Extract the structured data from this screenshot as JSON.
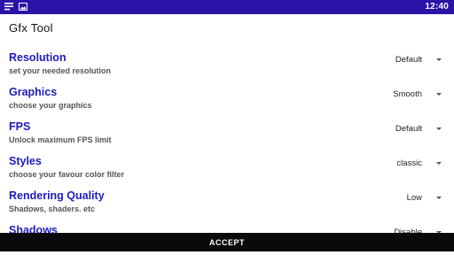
{
  "status_bar": {
    "time": "12:40",
    "background": "#2a13a7",
    "icons": [
      "notes-icon",
      "image-icon"
    ]
  },
  "app": {
    "title": "Gfx Tool"
  },
  "settings": [
    {
      "title": "Resolution",
      "subtitle": "set your needed resolution",
      "value": "Default"
    },
    {
      "title": "Graphics",
      "subtitle": "choose your graphics",
      "value": "Smooth"
    },
    {
      "title": "FPS",
      "subtitle": "Unlock maximum FPS limit",
      "value": "Default"
    },
    {
      "title": "Styles",
      "subtitle": "choose your favour color filter",
      "value": "classic"
    },
    {
      "title": "Rendering Quality",
      "subtitle": "Shadows, shaders. etc",
      "value": "Low"
    },
    {
      "title": "Shadows",
      "subtitle": "",
      "value": "Disable"
    }
  ],
  "accept_button": {
    "label": "ACCEPT"
  },
  "colors": {
    "title": "#1d1db4",
    "subtitle": "#555555",
    "accept_bg": "#0a0a0a"
  }
}
